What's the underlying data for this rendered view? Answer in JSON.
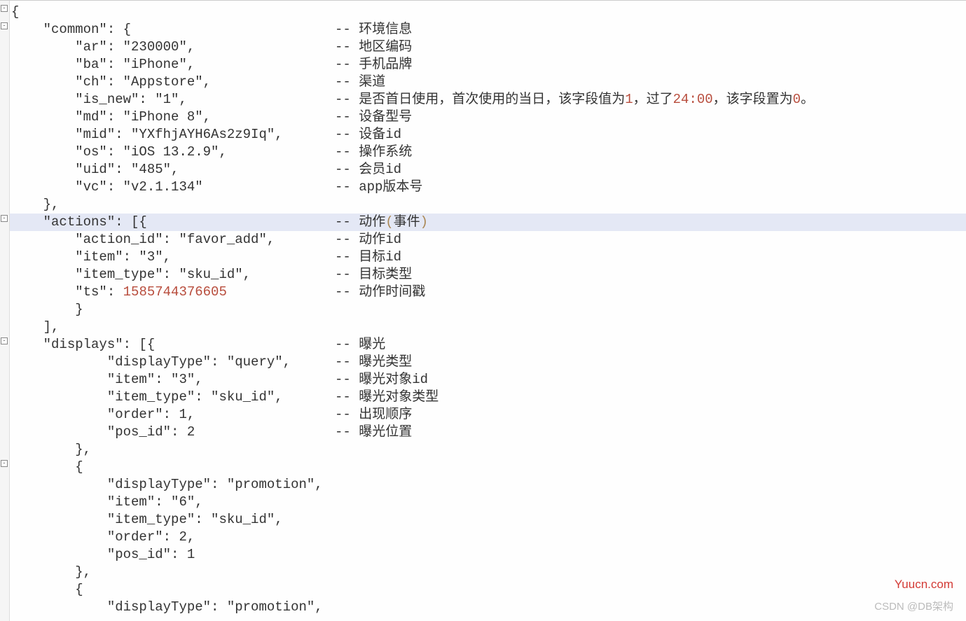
{
  "gutter": {
    "fold_positions": [
      6,
      31,
      306,
      481,
      656
    ]
  },
  "lines": [
    {
      "code": "{",
      "comment": ""
    },
    {
      "code": "    \"common\": {",
      "comment": "-- 环境信息"
    },
    {
      "code": "        \"ar\": \"230000\",",
      "comment": "-- 地区编码"
    },
    {
      "code": "        \"ba\": \"iPhone\",",
      "comment": "-- 手机品牌"
    },
    {
      "code": "        \"ch\": \"Appstore\",",
      "comment": "-- 渠道"
    },
    {
      "code": "        \"is_new\": \"1\",",
      "comment": "-- 是否首日使用，首次使用的当日，该字段值为1，过了24:00，该字段置为0。"
    },
    {
      "code": "        \"md\": \"iPhone 8\",",
      "comment": "-- 设备型号"
    },
    {
      "code": "        \"mid\": \"YXfhjAYH6As2z9Iq\",",
      "comment": "-- 设备id"
    },
    {
      "code": "        \"os\": \"iOS 13.2.9\",",
      "comment": "-- 操作系统"
    },
    {
      "code": "        \"uid\": \"485\",",
      "comment": "-- 会员id"
    },
    {
      "code": "        \"vc\": \"v2.1.134\"",
      "comment": "-- app版本号"
    },
    {
      "code": "    },",
      "comment": ""
    },
    {
      "code": "    \"actions\": [{",
      "comment": "-- 动作(事件)",
      "hl": true
    },
    {
      "code": "        \"action_id\": \"favor_add\",",
      "comment": "-- 动作id"
    },
    {
      "code": "        \"item\": \"3\",",
      "comment": "-- 目标id"
    },
    {
      "code": "        \"item_type\": \"sku_id\",",
      "comment": "-- 目标类型"
    },
    {
      "code": "        \"ts\": 1585744376605",
      "comment": "-- 动作时间戳",
      "is_num": true
    },
    {
      "code": "        }",
      "comment": ""
    },
    {
      "code": "    ],",
      "comment": ""
    },
    {
      "code": "    \"displays\": [{",
      "comment": "-- 曝光"
    },
    {
      "code": "            \"displayType\": \"query\",",
      "comment": "-- 曝光类型"
    },
    {
      "code": "            \"item\": \"3\",",
      "comment": "-- 曝光对象id"
    },
    {
      "code": "            \"item_type\": \"sku_id\",",
      "comment": "-- 曝光对象类型"
    },
    {
      "code": "            \"order\": 1,",
      "comment": "-- 出现顺序"
    },
    {
      "code": "            \"pos_id\": 2",
      "comment": "-- 曝光位置"
    },
    {
      "code": "        },",
      "comment": ""
    },
    {
      "code": "        {",
      "comment": ""
    },
    {
      "code": "            \"displayType\": \"promotion\",",
      "comment": ""
    },
    {
      "code": "            \"item\": \"6\",",
      "comment": ""
    },
    {
      "code": "            \"item_type\": \"sku_id\",",
      "comment": ""
    },
    {
      "code": "            \"order\": 2,",
      "comment": ""
    },
    {
      "code": "            \"pos_id\": 1",
      "comment": ""
    },
    {
      "code": "        },",
      "comment": ""
    },
    {
      "code": "        {",
      "comment": ""
    },
    {
      "code": "            \"displayType\": \"promotion\",",
      "comment": ""
    }
  ],
  "watermarks": {
    "yuucn": "Yuucn.com",
    "csdn": "CSDN @DB架构"
  }
}
